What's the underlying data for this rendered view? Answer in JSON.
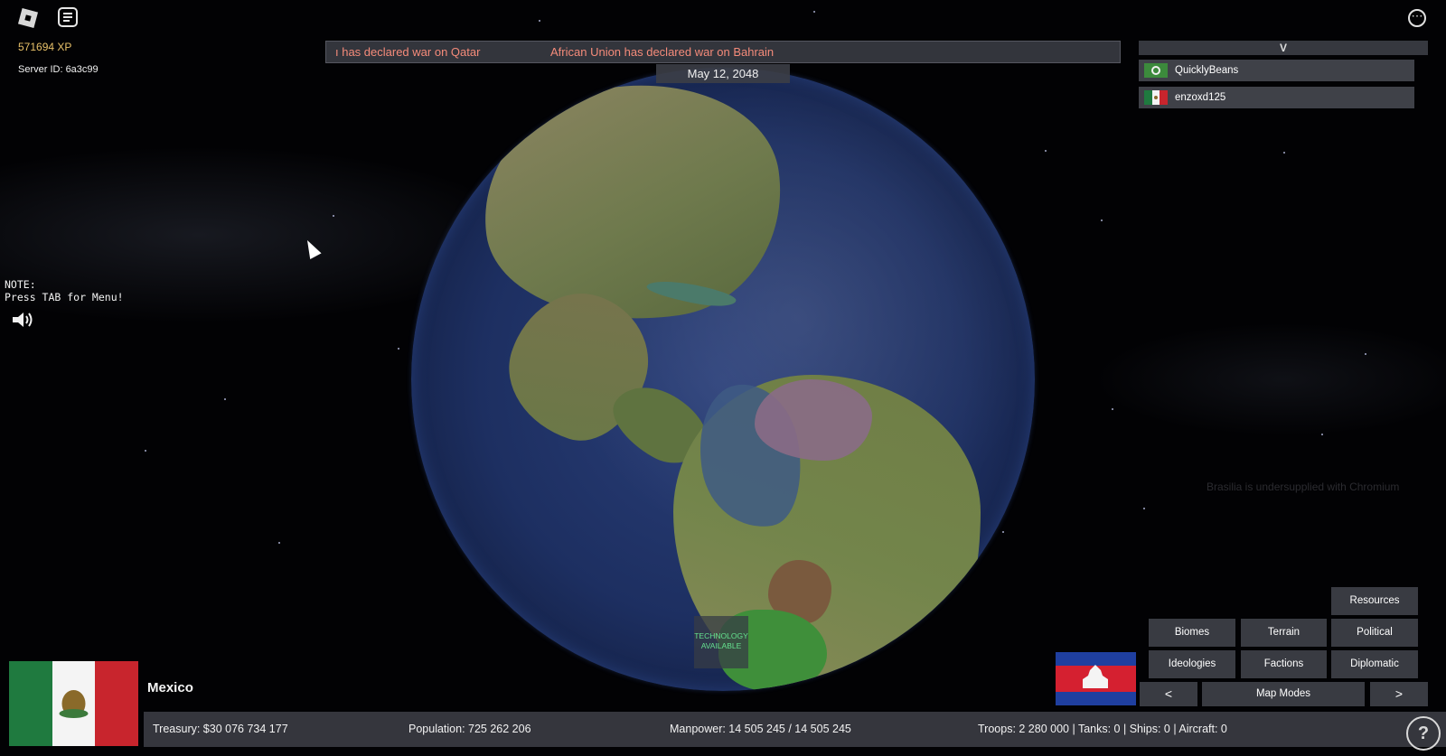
{
  "hud": {
    "xp": "571694 XP",
    "server_id": "Server ID: 6a3c99",
    "note": "NOTE:\nPress TAB for Menu!"
  },
  "ticker": {
    "message_1": "ı has declared war on Qatar",
    "message_2": "African Union has declared war on Bahrain"
  },
  "date": "May 12, 2048",
  "player_list": {
    "header": "V",
    "players": [
      {
        "name": "QuicklyBeans"
      },
      {
        "name": "enzoxd125"
      }
    ]
  },
  "faded_notification": "Brasilia is undersupplied with Chromium",
  "tech_badge": "TECHNOLOGY AVAILABLE",
  "map_modes": {
    "resources": "Resources",
    "biomes": "Biomes",
    "terrain": "Terrain",
    "political": "Political",
    "ideologies": "Ideologies",
    "factions": "Factions",
    "diplomatic": "Diplomatic",
    "prev": "<",
    "label": "Map Modes",
    "next": ">"
  },
  "country": {
    "name": "Mexico"
  },
  "stats": {
    "treasury": "Treasury:  $30 076 734 177",
    "population": "Population: 725 262 206",
    "manpower": "Manpower:  14 505 245  /  14 505 245",
    "military": "Troops: 2 280 000  |  Tanks: 0  |  Ships: 0  |  Aircraft: 0"
  },
  "icons": {
    "help": "?",
    "menu": "⋯"
  },
  "colors": {
    "ticker_text": "#f58b7a",
    "xp_text": "#e8c169",
    "tech_text": "#65e28f"
  }
}
